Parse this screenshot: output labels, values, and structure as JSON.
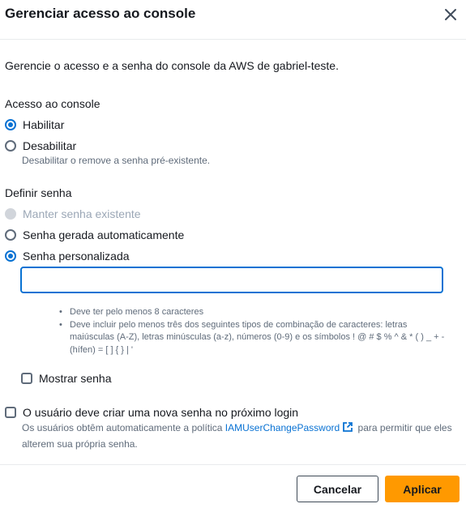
{
  "modal": {
    "title": "Gerenciar acesso ao console",
    "close_icon": "close-icon",
    "description": "Gerencie o acesso e a senha do console da AWS de gabriel-teste."
  },
  "console_access": {
    "label": "Acesso ao console",
    "options": [
      {
        "label": "Habilitar",
        "checked": true
      },
      {
        "label": "Desabilitar",
        "checked": false,
        "hint": "Desabilitar o remove a senha pré-existente."
      }
    ]
  },
  "password": {
    "label": "Definir senha",
    "options": [
      {
        "label": "Manter senha existente",
        "checked": false,
        "disabled": true
      },
      {
        "label": "Senha gerada automaticamente",
        "checked": false
      },
      {
        "label": "Senha personalizada",
        "checked": true
      }
    ],
    "input_value": "",
    "rules": [
      "Deve ter pelo menos 8 caracteres",
      "Deve incluir pelo menos três dos seguintes tipos de combinação de caracteres: letras maiúsculas (A-Z), letras minúsculas (a-z), números (0-9) e os símbolos ! @ # $ % ^ & * ( ) _ + - (hífen) = [ ] { } | '"
    ],
    "show_password_label": "Mostrar senha"
  },
  "reset": {
    "label": "O usuário deve criar uma nova senha no próximo login",
    "hint_before": "Os usuários obtêm automaticamente a política ",
    "link_text": "IAMUserChangePassword",
    "link_icon": "external-link-icon",
    "hint_after": " para permitir que eles alterem sua própria senha."
  },
  "footer": {
    "cancel_label": "Cancelar",
    "apply_label": "Aplicar"
  },
  "colors": {
    "primary": "#ff9900",
    "accent_blue": "#0972d3",
    "text": "#16191f",
    "secondary_text": "#5f6b7a"
  }
}
